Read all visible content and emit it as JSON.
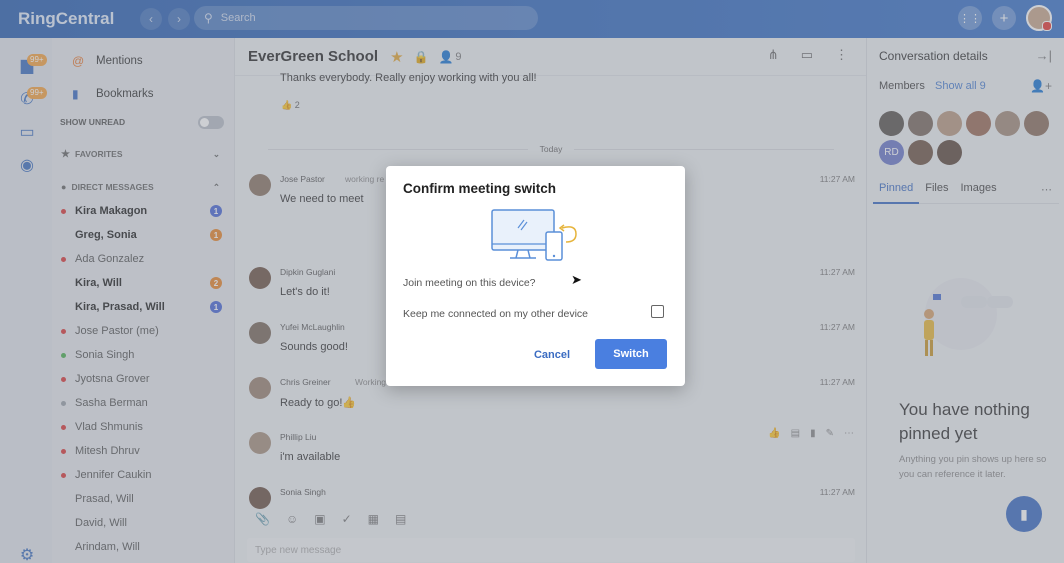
{
  "app": {
    "logo": "RingCentral"
  },
  "search": {
    "placeholder": "Search"
  },
  "rail": {
    "badge_messages": "99+",
    "badge_phone": "99+"
  },
  "sidebar": {
    "top_items": [
      {
        "label": "Mentions"
      },
      {
        "label": "Bookmarks"
      }
    ],
    "show_unread_label": "SHOW UNREAD",
    "favorites_label": "FAVORITES",
    "direct_messages_label": "DIRECT MESSAGES",
    "dms": [
      {
        "name": "Kira Makagon",
        "bold": true,
        "dot": "#d93a3a",
        "badge": "1",
        "badge_color": "#4a68d6"
      },
      {
        "name": "Greg, Sonia",
        "bold": true,
        "dot": "",
        "badge": "1",
        "badge_color": "#e8862c"
      },
      {
        "name": "Ada Gonzalez",
        "bold": false,
        "dot": "#d93a3a",
        "badge": "",
        "badge_color": ""
      },
      {
        "name": "Kira, Will",
        "bold": true,
        "dot": "",
        "badge": "2",
        "badge_color": "#e8862c"
      },
      {
        "name": "Kira, Prasad, Will",
        "bold": true,
        "dot": "",
        "badge": "1",
        "badge_color": "#4a68d6"
      },
      {
        "name": "Jose Pastor (me)",
        "bold": false,
        "dot": "#d93a3a",
        "badge": "",
        "badge_color": ""
      },
      {
        "name": "Sonia Singh",
        "bold": false,
        "dot": "#4caf50",
        "badge": "",
        "badge_color": ""
      },
      {
        "name": "Jyotsna Grover",
        "bold": false,
        "dot": "#d93a3a",
        "badge": "",
        "badge_color": ""
      },
      {
        "name": "Sasha Berman",
        "bold": false,
        "dot": "#9aa0a8",
        "badge": "",
        "badge_color": ""
      },
      {
        "name": "Vlad Shmunis",
        "bold": false,
        "dot": "#d93a3a",
        "badge": "",
        "badge_color": ""
      },
      {
        "name": "Mitesh Dhruv",
        "bold": false,
        "dot": "#d93a3a",
        "badge": "",
        "badge_color": ""
      },
      {
        "name": "Jennifer Caukin",
        "bold": false,
        "dot": "#d93a3a",
        "badge": "",
        "badge_color": ""
      },
      {
        "name": "Prasad, Will",
        "bold": false,
        "dot": "",
        "badge": "",
        "badge_color": ""
      },
      {
        "name": "David, Will",
        "bold": false,
        "dot": "",
        "badge": "",
        "badge_color": ""
      },
      {
        "name": "Arindam, Will",
        "bold": false,
        "dot": "",
        "badge": "",
        "badge_color": ""
      }
    ]
  },
  "conversation": {
    "title": "EverGreen School",
    "member_count": "9",
    "first_message": "Thanks everybody.  Really enjoy working with you all!",
    "reaction_count": "2",
    "today_label": "Today",
    "messages": [
      {
        "name": "Jose Pastor",
        "status": "working re",
        "text": "We need to meet",
        "time": "11:27 AM"
      },
      {
        "name": "Dipkin Guglani",
        "status": "",
        "text": "Let's do it!",
        "time": "11:27 AM"
      },
      {
        "name": "Yufei McLaughlin",
        "status": "",
        "text": "Sounds good!",
        "time": "11:27 AM"
      },
      {
        "name": "Chris Greiner",
        "status": "Working",
        "text": "Ready to go!👍",
        "time": "11:27 AM"
      },
      {
        "name": "Phillip Liu",
        "status": "",
        "text": "i'm available",
        "time": ""
      },
      {
        "name": "Sonia Singh",
        "status": "",
        "text": "",
        "time": "11:27 AM"
      }
    ],
    "composer_placeholder": "Type new message"
  },
  "details": {
    "title": "Conversation details",
    "members_label": "Members",
    "show_all": "Show all 9",
    "rd_initials": "RD",
    "tabs": [
      "Pinned",
      "Files",
      "Images"
    ],
    "empty_title": "You have nothing pinned yet",
    "empty_sub": "Anything you pin shows up here so you can reference it later."
  },
  "dialog": {
    "title": "Confirm meeting switch",
    "question": "Join meeting on this device?",
    "checkbox_label": "Keep me connected on my other device",
    "cancel_label": "Cancel",
    "switch_label": "Switch"
  }
}
